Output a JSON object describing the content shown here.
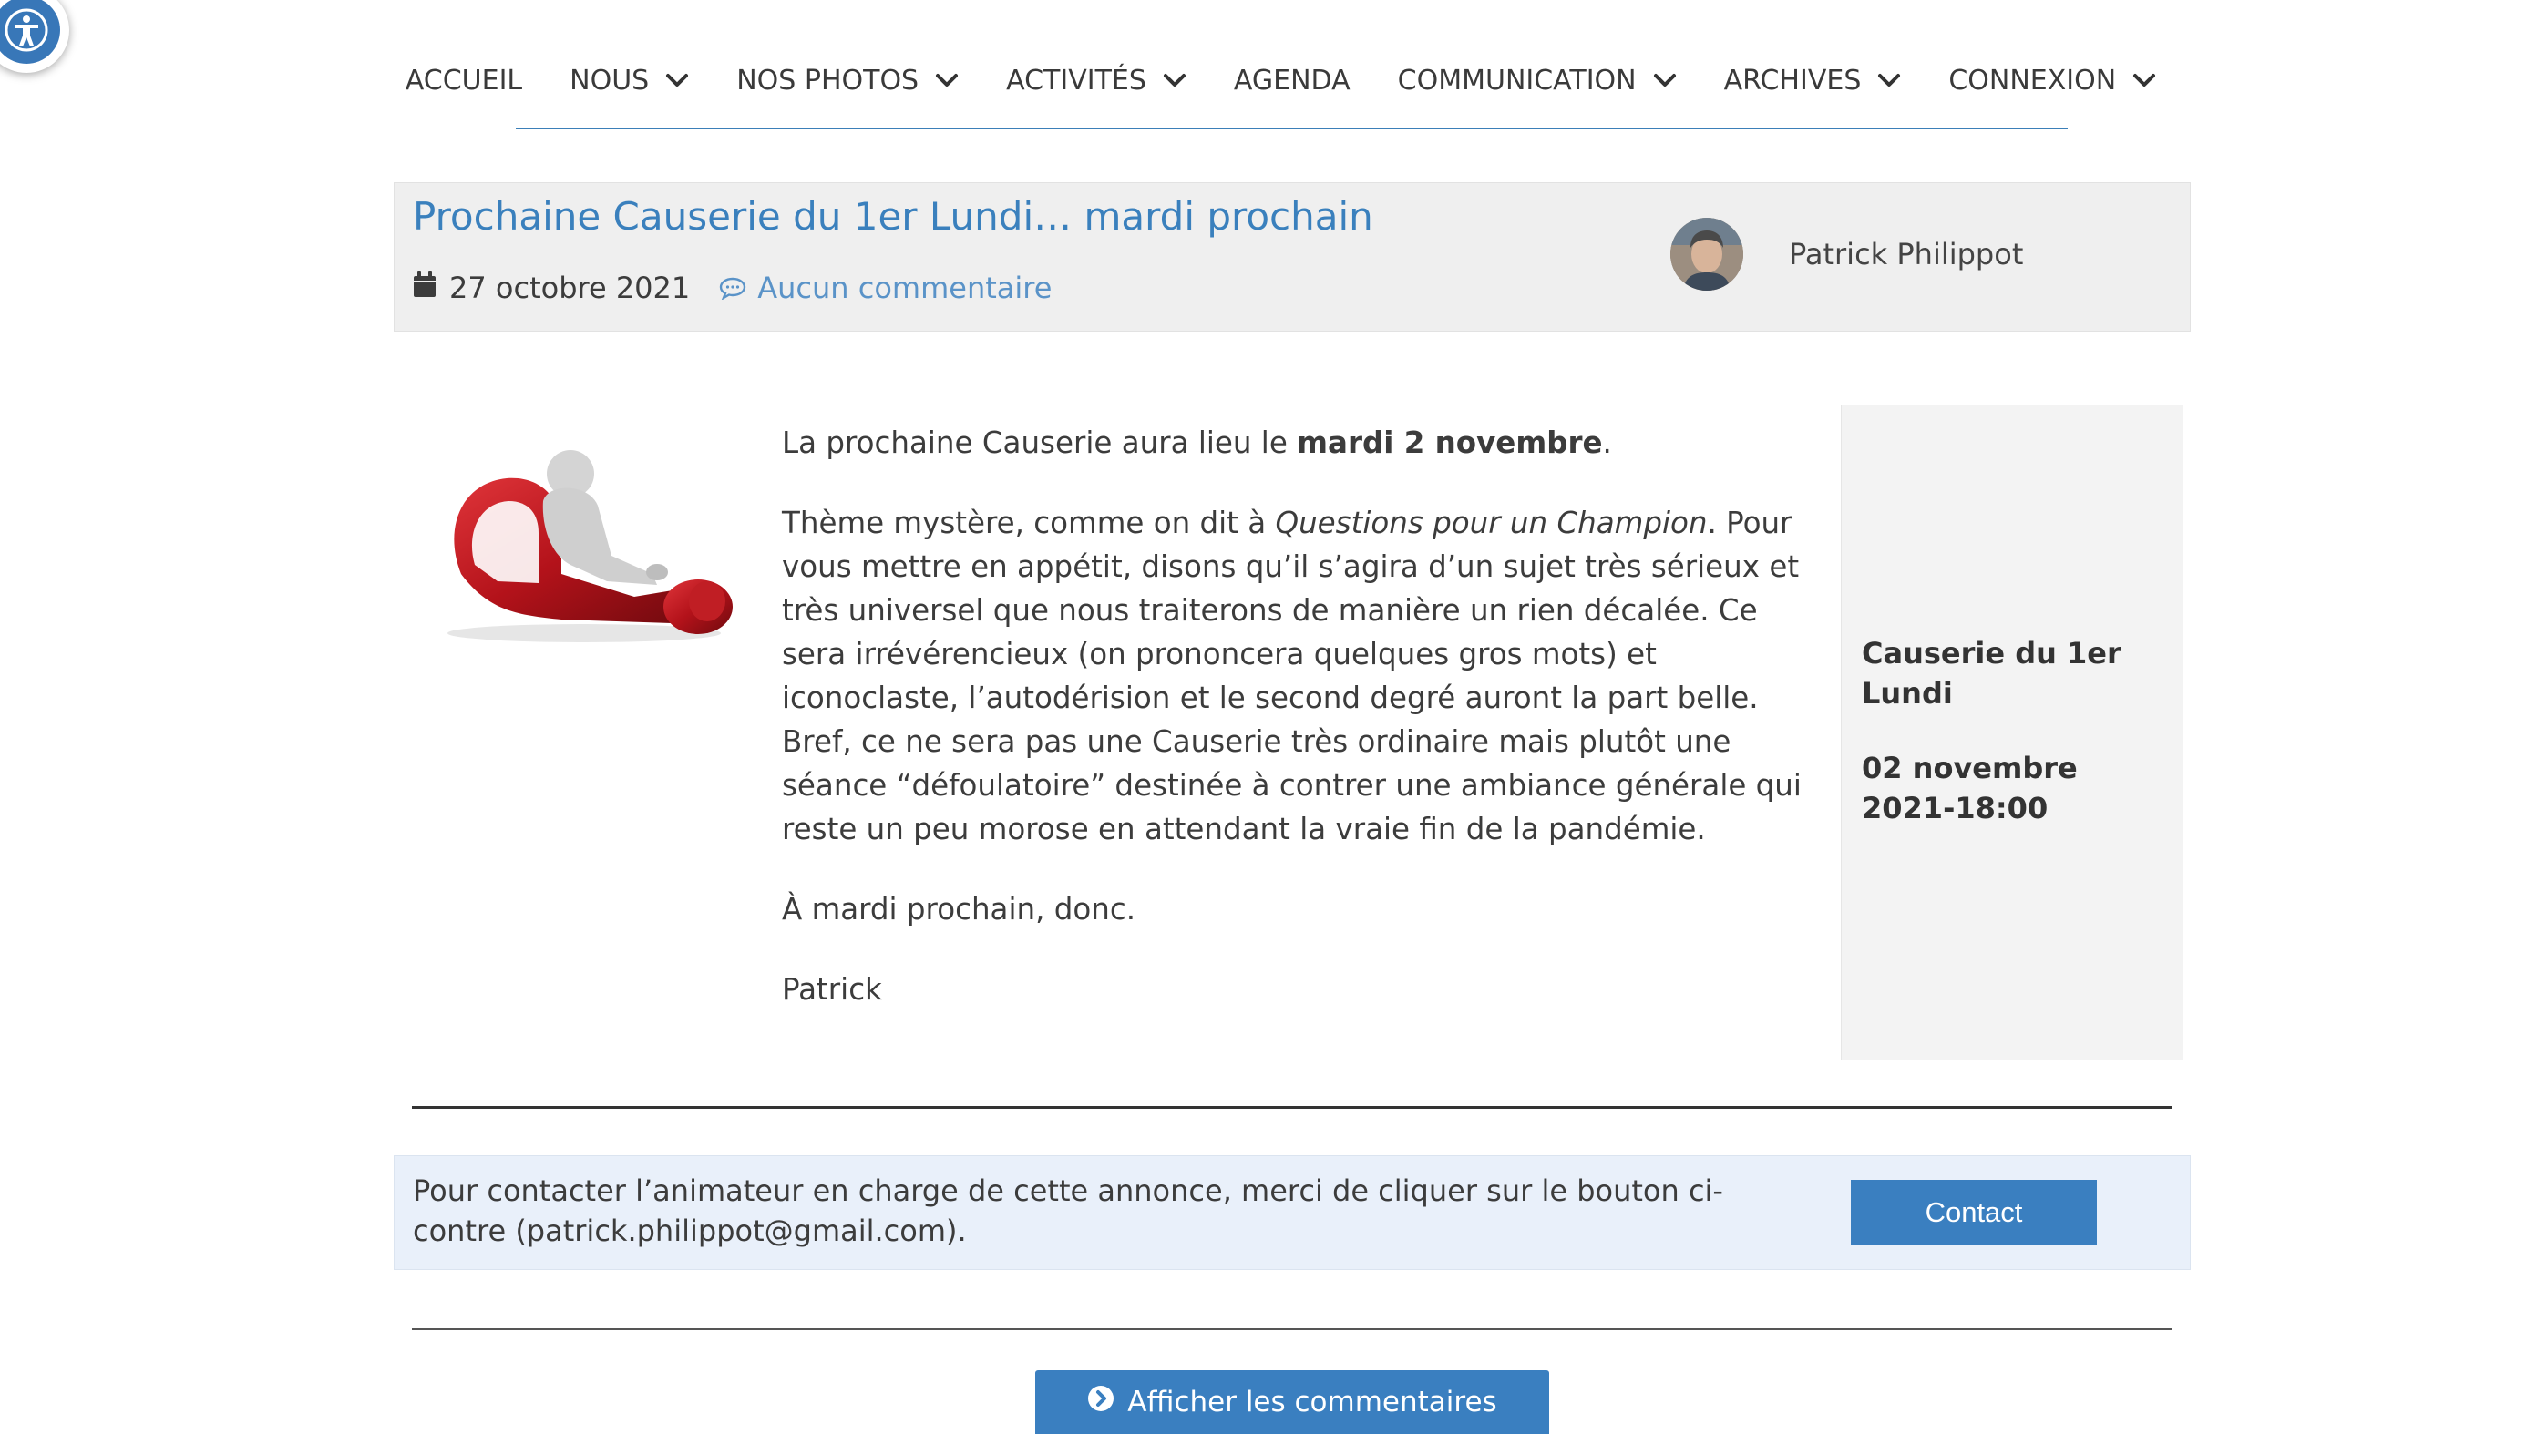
{
  "nav": {
    "items": [
      {
        "label": "ACCUEIL",
        "dropdown": false
      },
      {
        "label": "NOUS",
        "dropdown": true
      },
      {
        "label": "NOS PHOTOS",
        "dropdown": true
      },
      {
        "label": "ACTIVITÉS",
        "dropdown": true
      },
      {
        "label": "AGENDA",
        "dropdown": false
      },
      {
        "label": "COMMUNICATION",
        "dropdown": true
      },
      {
        "label": "ARCHIVES",
        "dropdown": true
      },
      {
        "label": "CONNEXION",
        "dropdown": true
      }
    ]
  },
  "post": {
    "title": "Prochaine Causerie du 1er Lundi… mardi prochain",
    "date": "27 octobre 2021",
    "comments": "Aucun commentaire",
    "author": "Patrick Philippot"
  },
  "article": {
    "p1_before": "La prochaine Causerie aura lieu le ",
    "p1_bold": "mardi 2 novembre",
    "p1_after": ".",
    "p2_before": "Thème mystère, comme on dit à ",
    "p2_italic": "Questions pour un Champion",
    "p2_after": ". Pour vous mettre en appétit, disons qu’il s’agira d’un sujet très sérieux et très universel que nous traiterons de manière un rien décalée. Ce sera irrévérencieux (on prononcera quelques gros mots) et iconoclaste, l’autodérision et le second degré auront la part belle. Bref, ce ne sera pas une Causerie très ordinaire mais plutôt une séance “défoulatoire” destinée à contrer une ambiance générale qui reste un peu morose en attendant la vraie fin de la pandémie.",
    "p3": "À mardi prochain, donc.",
    "p4": "Patrick"
  },
  "sidebar": {
    "event_title": "Causerie du 1er Lundi",
    "event_date": "02 novembre 2021-18:00"
  },
  "contact": {
    "text": "Pour contacter l’animateur en charge de cette annonce, merci de cliquer sur le bouton ci-contre (patrick.philippot@gmail.com).",
    "button": "Contact"
  },
  "comments_button": "Afficher les commentaires",
  "colors": {
    "accent": "#3a80bd",
    "button": "#3a7fc0",
    "header_bg": "#efefef",
    "contact_bg": "#e9f0fa"
  }
}
